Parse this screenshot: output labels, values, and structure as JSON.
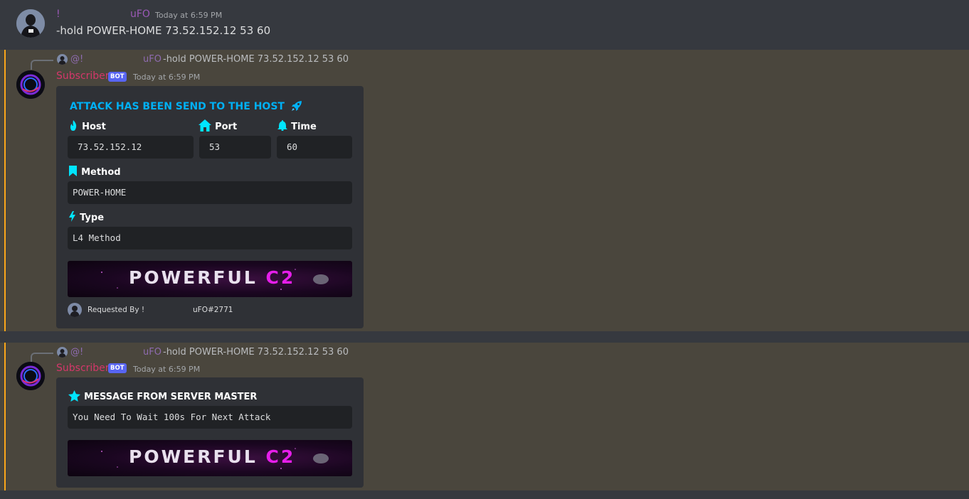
{
  "message1": {
    "username_prefix": "!",
    "username": "uFO",
    "timestamp": "Today at 6:59 PM",
    "content": "-hold POWER-HOME 73.52.152.12 53 60"
  },
  "reply": {
    "mention_prefix": "@!",
    "mention_name": "uFO",
    "text": "-hold POWER-HOME 73.52.152.12 53 60"
  },
  "bot": {
    "name": "Subscriber",
    "badge": "BOT",
    "timestamp": "Today at 6:59 PM"
  },
  "embed1": {
    "title": "ATTACK HAS BEEN SEND TO THE HOST",
    "fields": {
      "host": {
        "label": "Host",
        "value": "73.52.152.12"
      },
      "port": {
        "label": "Port",
        "value": "53"
      },
      "time": {
        "label": "Time",
        "value": "60"
      },
      "method": {
        "label": "Method",
        "value": "POWER-HOME"
      },
      "type": {
        "label": "Type",
        "value": "L4 Method"
      }
    },
    "banner": {
      "text_main": "POWERFUL",
      "text_accent": "C2"
    },
    "footer": {
      "requested_by": "Requested By !",
      "user": "uFO#2771"
    }
  },
  "embed2": {
    "title": "MESSAGE FROM SERVER MASTER",
    "value": "You Need To Wait 100s For Next Attack",
    "banner": {
      "text_main": "POWERFUL",
      "text_accent": "C2"
    }
  },
  "icons": {
    "title_icon": "rocket-icon",
    "host_icon": "fire-icon",
    "port_icon": "home-icon",
    "time_icon": "bell-icon",
    "method_icon": "bookmark-icon",
    "type_icon": "lightning-icon",
    "message_icon": "star-icon"
  },
  "colors": {
    "background": "#36393f",
    "highlight": "#4a463d",
    "highlight_bar": "#faa61a",
    "embed_bg": "#2f3136",
    "embed_title": "#00b0f4",
    "bot_badge": "#5865f2",
    "username": "#9b59b6",
    "bot_name": "#d4376a",
    "accent_icon": "#00e5ff"
  }
}
